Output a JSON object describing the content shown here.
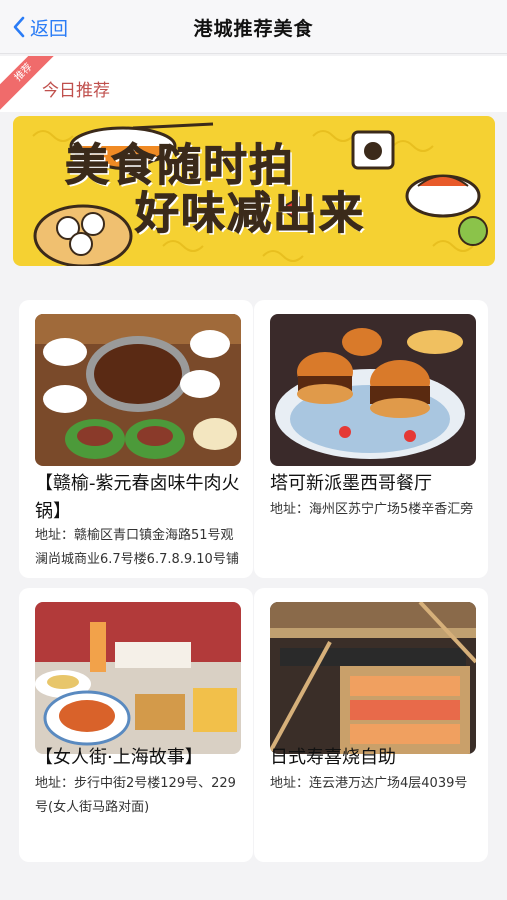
{
  "nav": {
    "back_label": "返回",
    "title": "港城推荐美食"
  },
  "section": {
    "ribbon": "推荐",
    "title": "今日推荐"
  },
  "banner": {
    "line1": "美食随时拍",
    "line2": "好味减出来"
  },
  "address_prefix": "地址：",
  "restaurants": [
    {
      "name": "【赣榆-紫元春卤味牛肉火锅】",
      "address": "赣榆区青口镇金海路51号观澜尚城商业6.7号楼6.7.8.9.10号铺"
    },
    {
      "name": "塔可新派墨西哥餐厅",
      "address": "海州区苏宁广场5楼辛香汇旁"
    },
    {
      "name": "【女人街·上海故事】",
      "address": "步行中街2号楼129号、229号(女人街马路对面)"
    },
    {
      "name": "日式寿喜烧自助",
      "address": "连云港万达广场4层4039号"
    }
  ]
}
